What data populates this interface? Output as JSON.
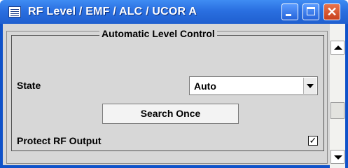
{
  "window": {
    "title": "RF Level / EMF / ALC / UCOR A"
  },
  "alc": {
    "group_title": "Automatic Level Control",
    "state_label": "State",
    "state_value": "Auto",
    "search_once_label": "Search Once",
    "protect_label": "Protect RF Output",
    "protect_checked": true,
    "protect_mark": "✓"
  },
  "icons": {
    "app": "grid-app-icon",
    "minimize": "minimize-icon",
    "maximize": "maximize-icon",
    "close": "close-icon",
    "close_glyph": "✕"
  },
  "colors": {
    "titlebar": "#2a6fe0",
    "client_background": "#d7d7d7",
    "close_button": "#c8401c"
  }
}
